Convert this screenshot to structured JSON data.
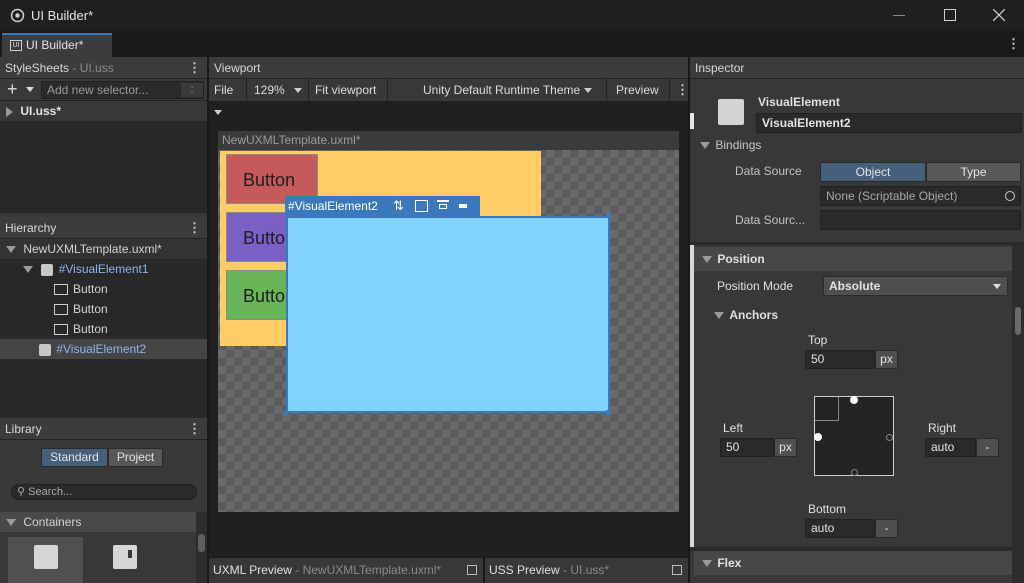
{
  "window": {
    "title": "UI Builder*",
    "tab": "UI Builder*"
  },
  "stylesheets": {
    "header": "StyleSheets",
    "file": "- UI.uss",
    "add_placeholder": "Add new selector...",
    "sheet": "UI.uss*"
  },
  "hierarchy": {
    "header": "Hierarchy",
    "root": "NewUXMLTemplate.uxml*",
    "ve1": "#VisualElement1",
    "btn1": "Button",
    "btn2": "Button",
    "btn3": "Button",
    "ve2": "#VisualElement2"
  },
  "library": {
    "header": "Library",
    "tab_standard": "Standard",
    "tab_project": "Project",
    "search_placeholder": "Search...",
    "section": "Containers",
    "item1": "VisualElement",
    "item2": "ScrollView"
  },
  "viewport": {
    "header": "Viewport",
    "file": "File",
    "zoom": "129%",
    "fit": "Fit viewport",
    "theme": "Unity Default Runtime Theme",
    "preview": "Preview",
    "canvas_title": "NewUXMLTemplate.uxml*",
    "btn1": "Button",
    "btn2": "Button",
    "btn3": "Button",
    "selected": "#VisualElement2"
  },
  "bottom": {
    "uxml": "UXML Preview",
    "uxml_file": "- NewUXMLTemplate.uxml*",
    "uss": "USS Preview",
    "uss_file": "- UI.uss*"
  },
  "inspector": {
    "header": "Inspector",
    "type": "VisualElement",
    "name": "VisualElement2",
    "bindings": "Bindings",
    "data_source_label": "Data Source",
    "tab_object": "Object",
    "tab_type": "Type",
    "data_source_value": "None (Scriptable Object)",
    "data_source_path_label": "Data Sourc...",
    "position": "Position",
    "position_mode_label": "Position Mode",
    "position_mode": "Absolute",
    "anchors": "Anchors",
    "top_label": "Top",
    "top_value": "50",
    "top_unit": "px",
    "left_label": "Left",
    "left_value": "50",
    "left_unit": "px",
    "right_label": "Right",
    "right_value": "auto",
    "right_unit": "-",
    "bottom_label": "Bottom",
    "bottom_value": "auto",
    "bottom_unit": "-",
    "flex": "Flex"
  },
  "colors": {
    "accent": "#3a79bb",
    "canvas_yellow": "#ffcc66",
    "button_red": "#c45a5a",
    "button_purple": "#7a5fc4",
    "button_green": "#6ab559",
    "selected_fill": "#80d2ff"
  }
}
